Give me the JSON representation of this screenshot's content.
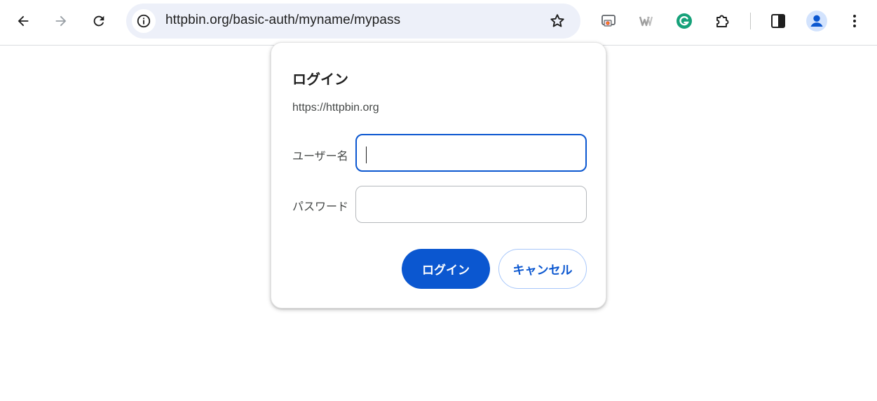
{
  "browser": {
    "address_bar": {
      "url": "httpbin.org/basic-auth/myname/mypass"
    },
    "icons": {
      "back": "back-arrow-icon",
      "forward": "forward-arrow-icon",
      "reload": "reload-icon",
      "site_info": "info-icon",
      "bookmark": "star-icon",
      "extensions": [
        "cast-icon",
        "word-icon",
        "grammarly-icon",
        "puzzle-icon"
      ],
      "side_panel": "side-panel-icon",
      "profile": "avatar-icon",
      "menu": "more-vertical-icon"
    }
  },
  "auth_dialog": {
    "title": "ログイン",
    "origin": "https://httpbin.org",
    "username_label": "ユーザー名",
    "username_value": "",
    "password_label": "パスワード",
    "password_value": "",
    "login_button": "ログイン",
    "cancel_button": "キャンセル"
  },
  "colors": {
    "accent": "#0b57d0",
    "omnibox_bg": "#edf0f9",
    "secondary_border": "#a8c7fa",
    "grammarly": "#15a179",
    "profile_bg": "#d3e3fd"
  }
}
